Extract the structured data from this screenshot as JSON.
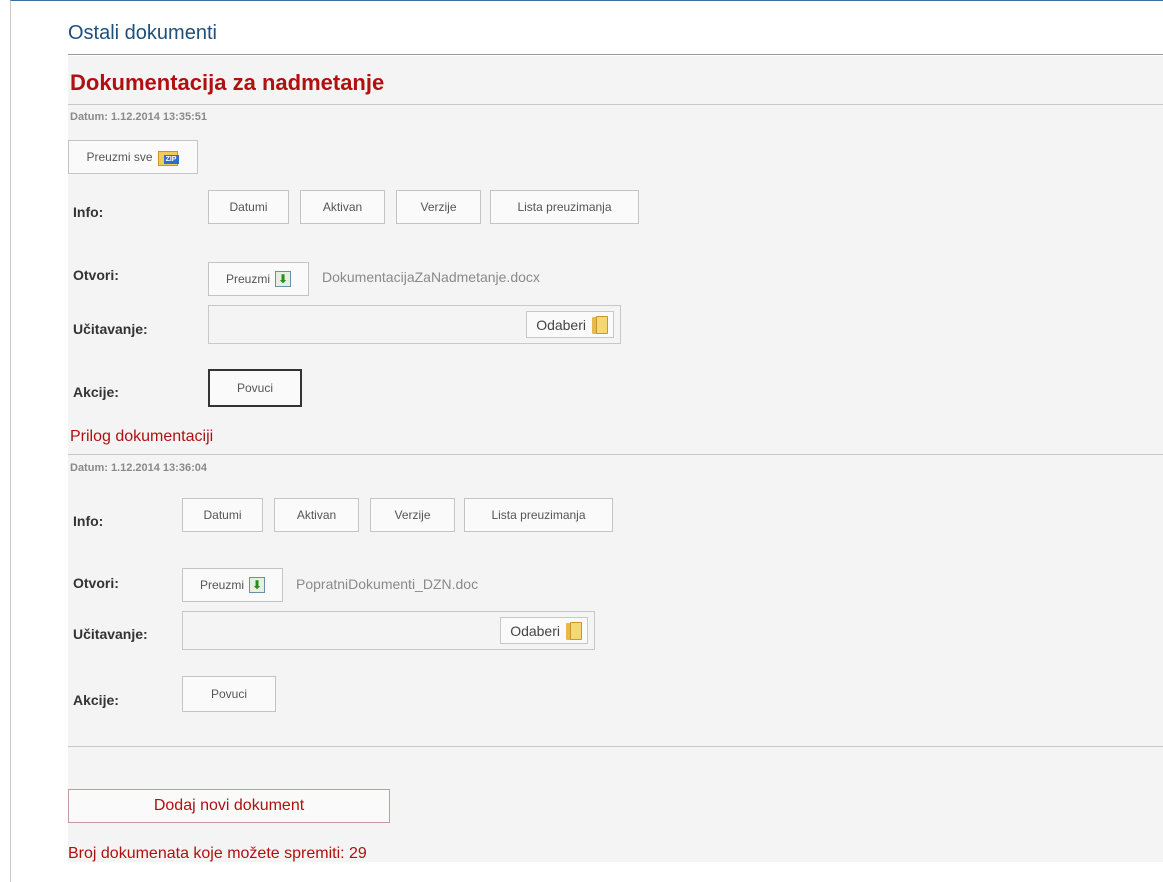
{
  "page": {
    "title": "Ostali dokumenti"
  },
  "section": {
    "title": "Dokumentacija za nadmetanje"
  },
  "documents": [
    {
      "date": "Datum: 1.12.2014 13:35:51",
      "download_all": "Preuzmi sve",
      "zip_text": "ZIP",
      "info_label": "Info:",
      "info_buttons": [
        "Datumi",
        "Aktivan",
        "Verzije",
        "Lista preuzimanja"
      ],
      "open_label": "Otvori:",
      "open_button": "Preuzmi",
      "file_name": "DokumentacijaZaNadmetanje.docx",
      "upload_label": "Učitavanje:",
      "choose_button": "Odaberi",
      "actions_label": "Akcije:",
      "withdraw_button": "Povuci"
    },
    {
      "title": "Prilog dokumentaciji",
      "date": "Datum: 1.12.2014 13:36:04",
      "info_label": "Info:",
      "info_buttons": [
        "Datumi",
        "Aktivan",
        "Verzije",
        "Lista preuzimanja"
      ],
      "open_label": "Otvori:",
      "open_button": "Preuzmi",
      "file_name": "PopratniDokumenti_DZN.doc",
      "upload_label": "Učitavanje:",
      "choose_button": "Odaberi",
      "actions_label": "Akcije:",
      "withdraw_button": "Povuci"
    }
  ],
  "add_button": "Dodaj novi dokument",
  "remaining": "Broj dokumenata koje možete spremiti: 29",
  "colors": {
    "accent_red": "#b01010",
    "title_blue": "#1f4f7a"
  }
}
